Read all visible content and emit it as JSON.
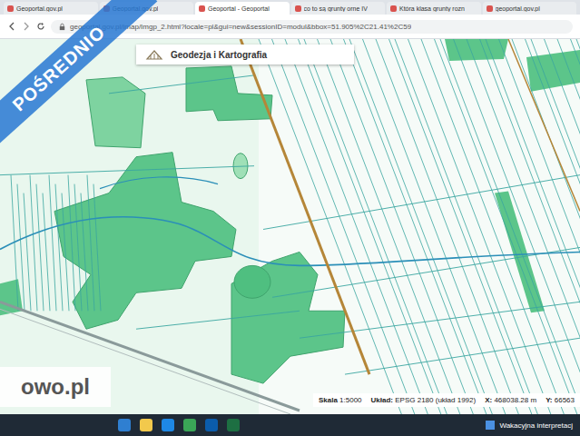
{
  "browser": {
    "tabs": [
      {
        "label": "Geoportal.gov.pl",
        "selected": false
      },
      {
        "label": "Geoportal.gov.pl",
        "selected": false
      },
      {
        "label": "Geoportal - Geoportal",
        "selected": true
      },
      {
        "label": "co to są grunty orne IV",
        "selected": false
      },
      {
        "label": "Która klasa grunty rozn",
        "selected": false
      },
      {
        "label": "geoportal.gov.pl",
        "selected": false
      }
    ],
    "address": "geoportal.gov.pl/imap/Imgp_2.html?locale=pl&gui=new&sessionID=modul&bbox=51.905%2C21.41%2C59"
  },
  "map": {
    "header": "Geodezja i Kartografia",
    "scale": {
      "label": "Skala",
      "value": "1:5000"
    },
    "system": {
      "label": "Układ:",
      "value": "EPSG 2180 (układ 1992)"
    },
    "x": {
      "label": "X:",
      "value": "468038.28 m"
    },
    "y": {
      "label": "Y:",
      "value": "66563"
    }
  },
  "watermarks": {
    "banner": "POŚREDNIO",
    "site": "owo.pl"
  },
  "taskbar": {
    "notification": "Wakacyjna interpretacj"
  }
}
